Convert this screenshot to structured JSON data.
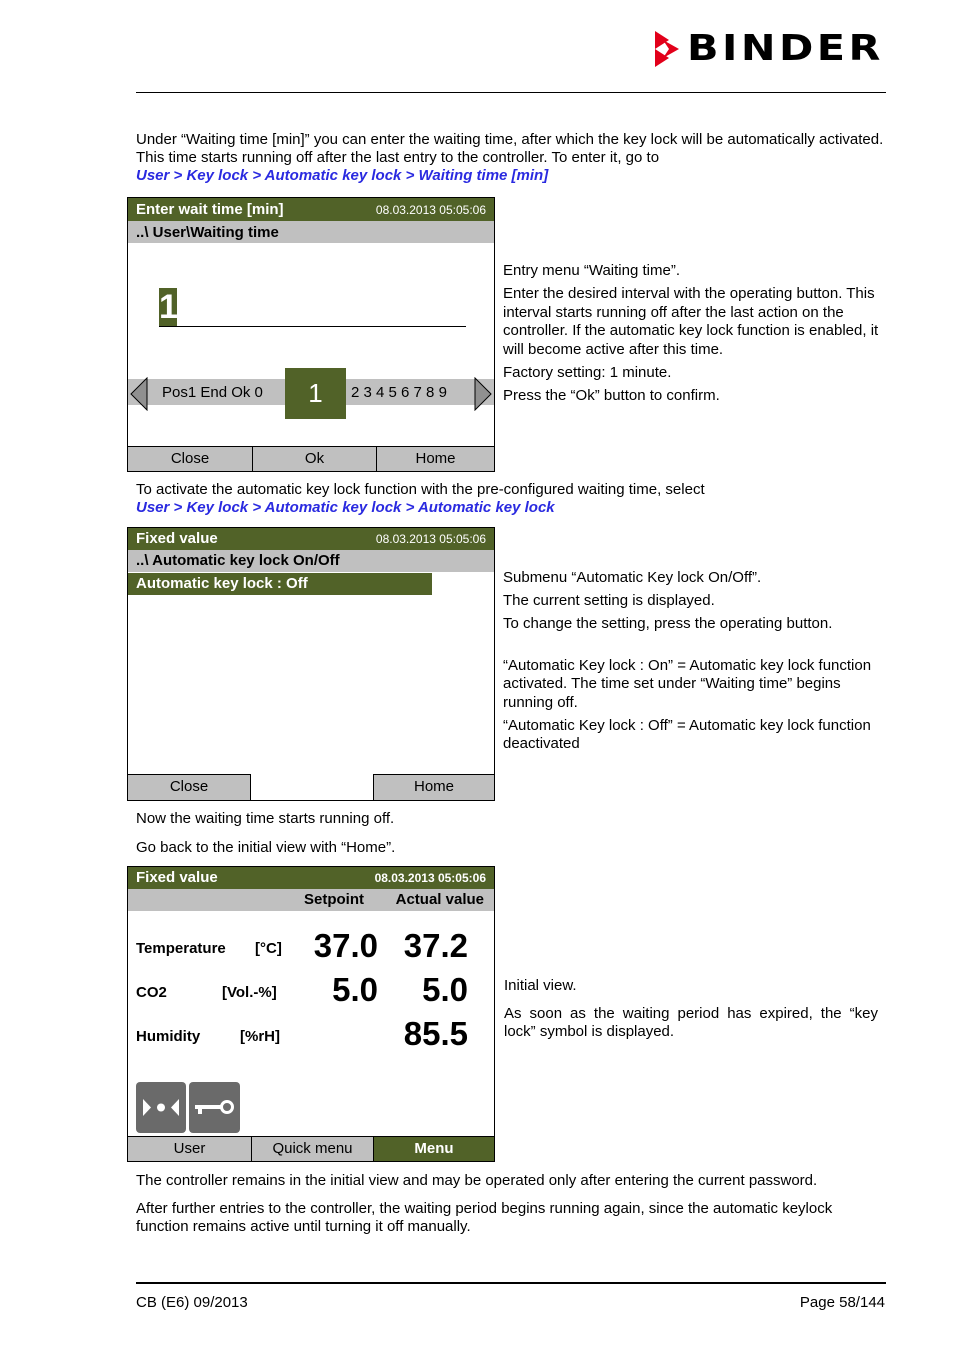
{
  "header": {
    "brand": "BINDER",
    "brand_color": "#e2001a"
  },
  "intro": {
    "text": "Under “Waiting time [min]” you can enter the waiting time, after which the key lock will be automatically activated. This time starts running off after the last entry to the controller. To enter it, go to",
    "path": "User > Key lock > Automatic key lock > Waiting time [min]"
  },
  "screen1": {
    "title": "Enter wait time [min]",
    "datetime": "08.03.2013  05:05:06",
    "path": "..\\ User\\Waiting time",
    "entry_value": "1",
    "selector_left": "Pos1 End Ok 0",
    "selector_current": "1",
    "selector_right": "2 3 4 5 6 7 8 9",
    "buttons": [
      "Close",
      "Ok",
      "Home"
    ]
  },
  "side1": [
    "Entry menu “Waiting time”.",
    "Enter the desired interval with the operating button. This interval starts running off after the last action on the controller. If the automatic key lock function is enabled, it will become active after this time.",
    "Factory setting: 1 minute.",
    "Press the “Ok” button to confirm."
  ],
  "activate": {
    "text": "To activate the automatic key lock function with the pre-configured waiting time, select",
    "path": "User > Key lock > Automatic key lock > Automatic key lock"
  },
  "screen2": {
    "title": "Fixed value",
    "datetime": "08.03.2013  05:05:06",
    "path": "..\\ Automatic key lock On/Off",
    "selected_item": "Automatic key lock : Off",
    "buttons": [
      "Close",
      "",
      "Home"
    ]
  },
  "side2": [
    "Submenu “Automatic Key lock On/Off”.",
    "The current setting is displayed.",
    "To change the setting, press the operating button.",
    "“Automatic Key lock : On” = Automatic key lock function activated. The time set under “Waiting time” begins running off.",
    "“Automatic Key lock : Off” = Automatic key lock function deactivated"
  ],
  "middle": {
    "line1": "Now the waiting time starts running off.",
    "line2": "Go back to the initial view with “Home”."
  },
  "screen3": {
    "title": "Fixed value",
    "datetime": "08.03.2013  05:05:06",
    "col_setpoint": "Setpoint",
    "col_actual": "Actual value",
    "rows": [
      {
        "name": "Temperature",
        "unit": "[°C]",
        "setpoint": "37.0",
        "actual": "37.2"
      },
      {
        "name": "CO2",
        "unit": "[Vol.-%]",
        "setpoint": "5.0",
        "actual": "5.0"
      },
      {
        "name": "Humidity",
        "unit": "[%rH]",
        "setpoint": "",
        "actual": "85.5"
      }
    ],
    "icons": [
      "door-icon",
      "key-icon"
    ],
    "buttons": [
      "User",
      "Quick menu",
      "Menu"
    ]
  },
  "side3": [
    "Initial view.",
    "As soon as the waiting period has expired, the “key lock” symbol is displayed."
  ],
  "closing": {
    "p1": "The controller remains in the initial view and may be operated only after entering the current password.",
    "p2": "After further entries to the controller, the waiting period begins running again, since the automatic keylock function remains active until turning it off manually."
  },
  "footer": {
    "left": "CB (E6) 09/2013",
    "right": "Page 58/144"
  }
}
